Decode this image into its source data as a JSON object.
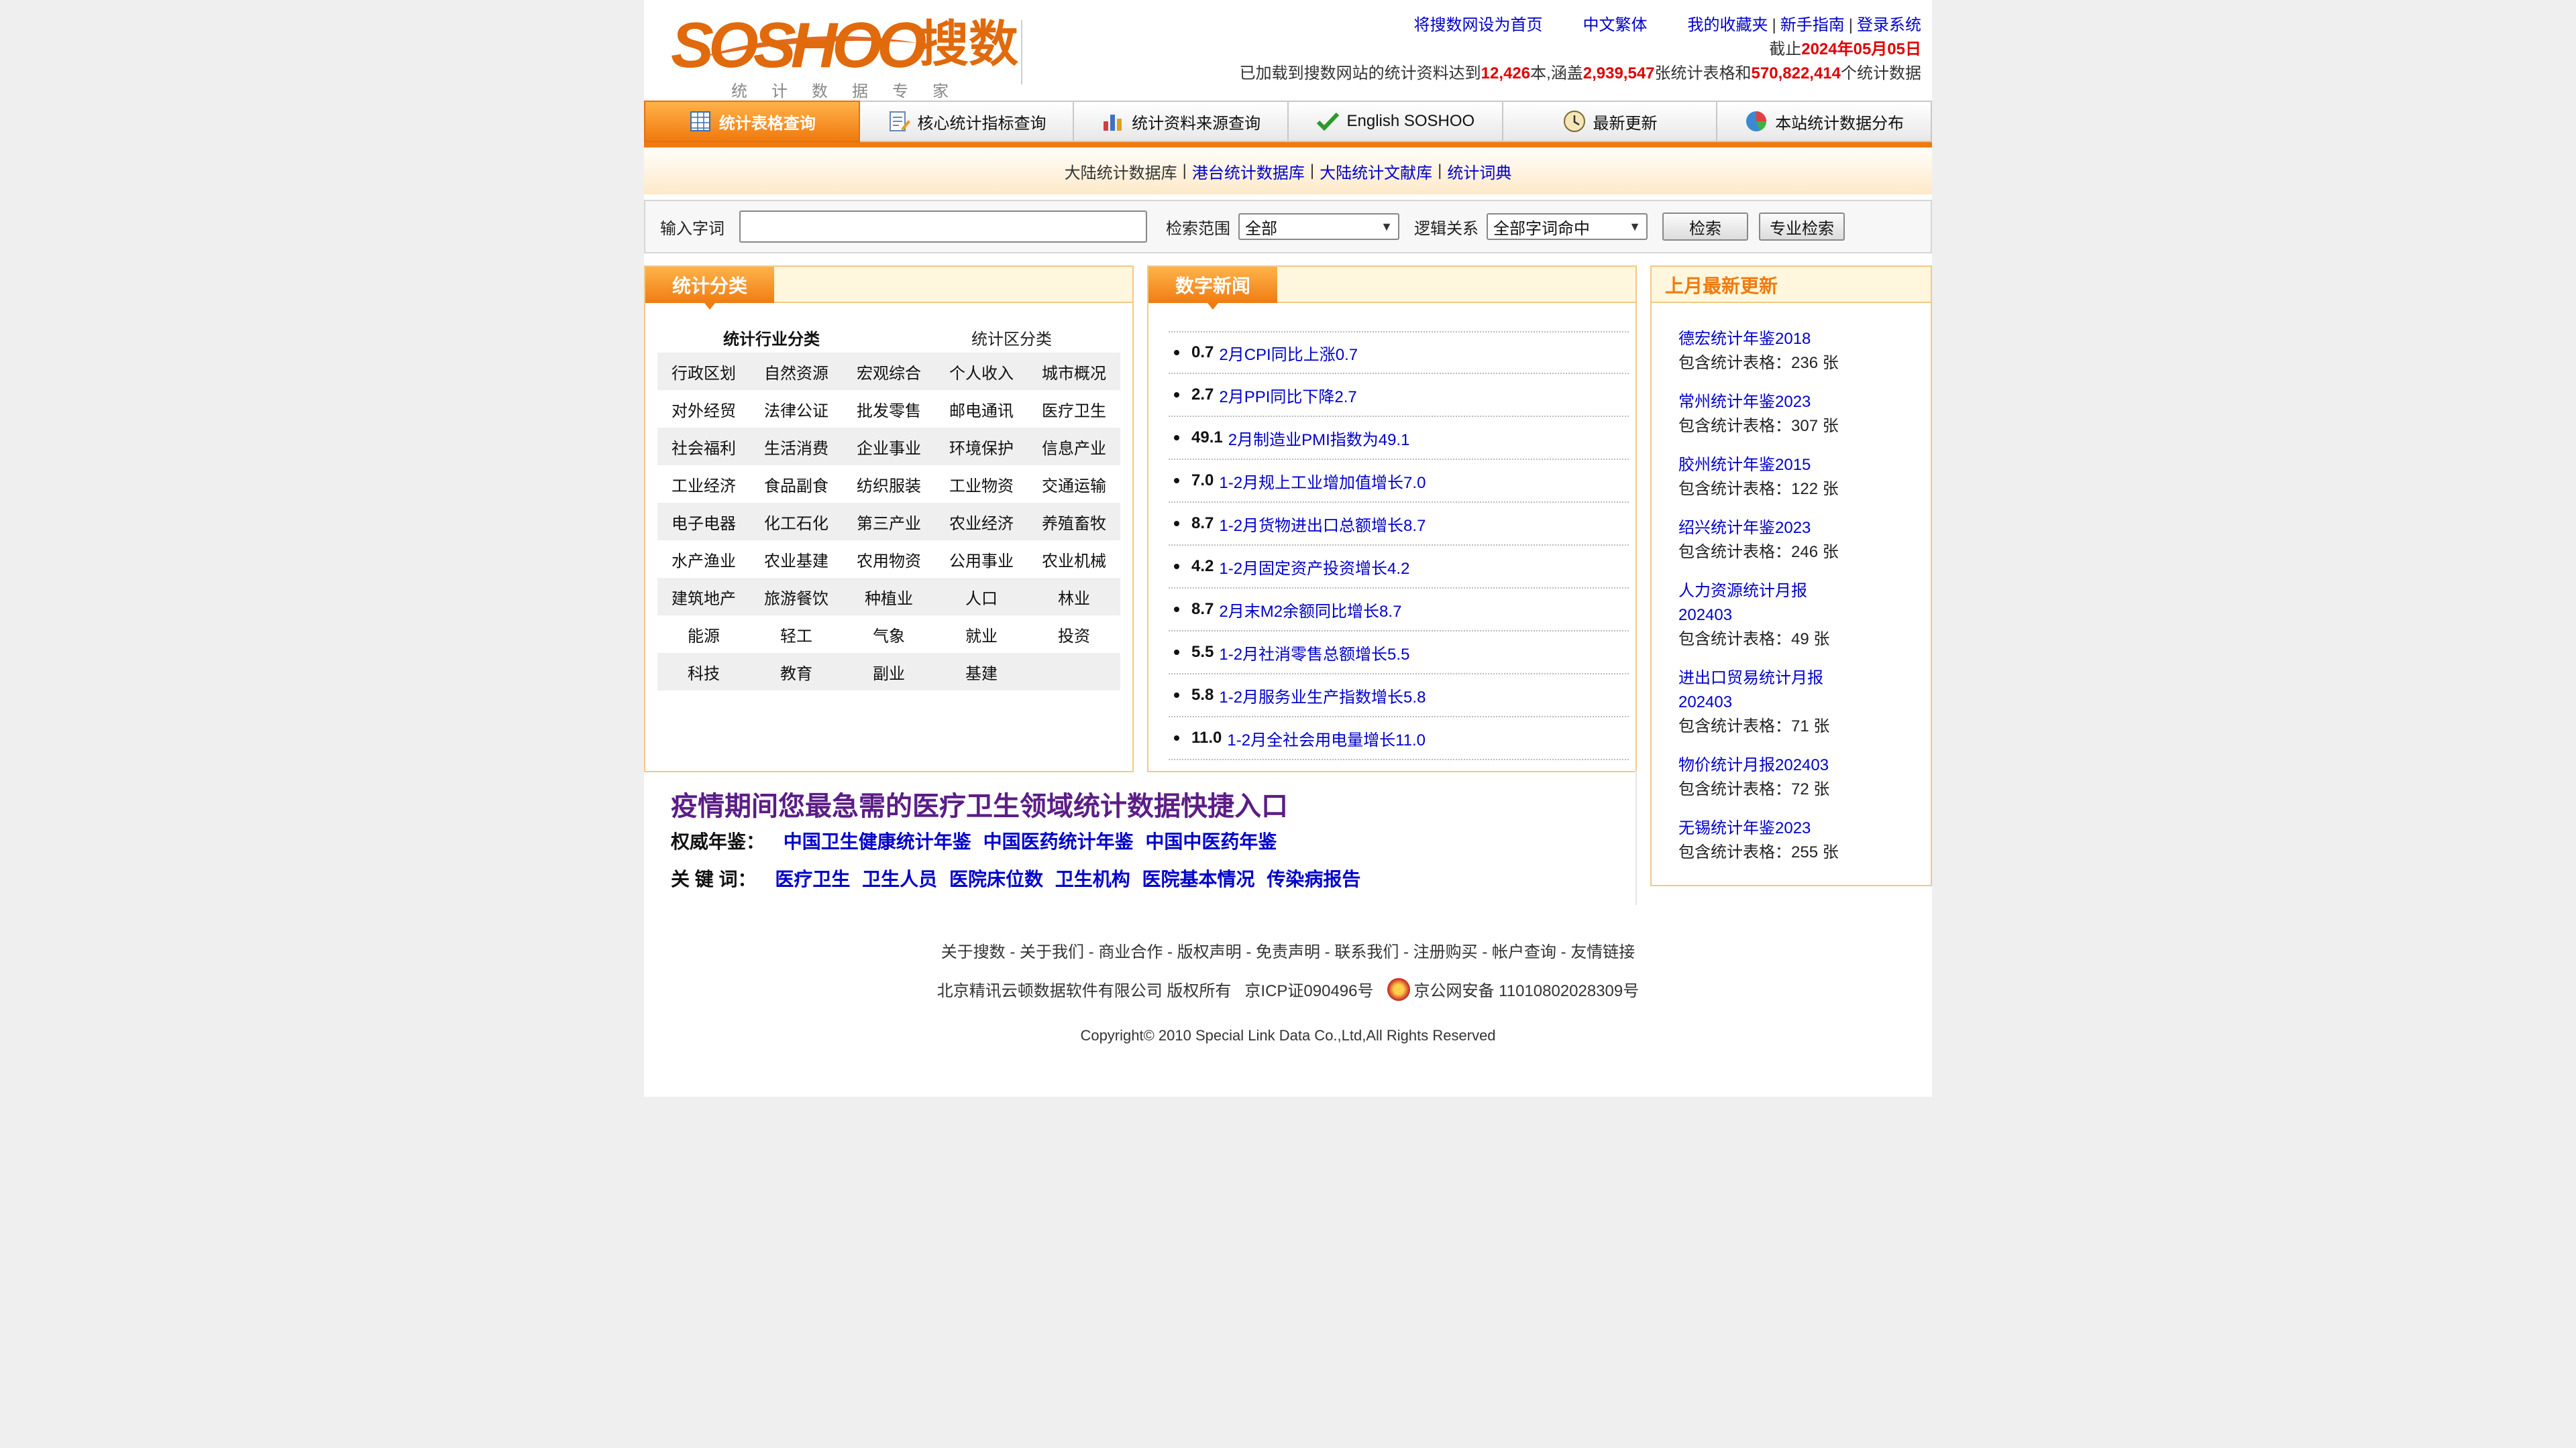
{
  "brand": {
    "logo_word": "SOSHOO",
    "logo_cn": "搜数",
    "logo_sub": "统计数据专家"
  },
  "top_links": {
    "set_home": "将搜数网设为首页",
    "traditional": "中文繁体",
    "favorites": "我的收藏夹",
    "guide": "新手指南",
    "login": "登录系统",
    "sep": "|",
    "date_prefix": "截止",
    "date_value": "2024年05月05日",
    "stats_p1": "已加载到搜数网站的统计资料达到",
    "books": "12,426",
    "stats_p2": "本,涵盖",
    "tables": "2,939,547",
    "stats_p3": "张统计表格和",
    "data_count": "570,822,414",
    "stats_p4": "个统计数据"
  },
  "nav": {
    "tabs": [
      {
        "label": "统计表格查询",
        "icon": "table-icon",
        "active": true
      },
      {
        "label": "核心统计指标查询",
        "icon": "document-edit-icon",
        "active": false
      },
      {
        "label": "统计资料来源查询",
        "icon": "bar-chart-icon",
        "active": false
      },
      {
        "label": "English SOSHOO",
        "icon": "checkmark-icon",
        "active": false
      },
      {
        "label": "最新更新",
        "icon": "clock-icon",
        "active": false
      },
      {
        "label": "本站统计数据分布",
        "icon": "pie-chart-icon",
        "active": false
      }
    ]
  },
  "db_bar": {
    "items": [
      "大陆统计数据库",
      "港台统计数据库",
      "大陆统计文献库",
      "统计词典"
    ],
    "sep": "|"
  },
  "search": {
    "input_label": "输入字词",
    "input_value": "",
    "scope_label": "检索范围",
    "scope_value": "全部",
    "logic_label": "逻辑关系",
    "logic_value": "全部字词命中",
    "search_button": "检索",
    "advanced_button": "专业检索"
  },
  "categories": {
    "title": "统计分类",
    "industry_head": "统计行业分类",
    "region_head": "统计区分类",
    "rows": [
      [
        "行政区划",
        "自然资源",
        "宏观综合",
        "个人收入",
        "城市概况"
      ],
      [
        "对外经贸",
        "法律公证",
        "批发零售",
        "邮电通讯",
        "医疗卫生"
      ],
      [
        "社会福利",
        "生活消费",
        "企业事业",
        "环境保护",
        "信息产业"
      ],
      [
        "工业经济",
        "食品副食",
        "纺织服装",
        "工业物资",
        "交通运输"
      ],
      [
        "电子电器",
        "化工石化",
        "第三产业",
        "农业经济",
        "养殖畜牧"
      ],
      [
        "水产渔业",
        "农业基建",
        "农用物资",
        "公用事业",
        "农业机械"
      ],
      [
        "建筑地产",
        "旅游餐饮",
        "种植业",
        "人口",
        "林业"
      ],
      [
        "能源",
        "轻工",
        "气象",
        "就业",
        "投资"
      ],
      [
        "科技",
        "教育",
        "副业",
        "基建",
        ""
      ]
    ]
  },
  "news": {
    "title": "数字新闻",
    "items": [
      {
        "value": "0.7",
        "text": "2月CPI同比上涨0.7"
      },
      {
        "value": "2.7",
        "text": "2月PPI同比下降2.7"
      },
      {
        "value": "49.1",
        "text": "2月制造业PMI指数为49.1"
      },
      {
        "value": "7.0",
        "text": "1-2月规上工业增加值增长7.0"
      },
      {
        "value": "8.7",
        "text": "1-2月货物进出口总额增长8.7"
      },
      {
        "value": "4.2",
        "text": "1-2月固定资产投资增长4.2"
      },
      {
        "value": "8.7",
        "text": "2月末M2余额同比增长8.7"
      },
      {
        "value": "5.5",
        "text": "1-2月社消零售总额增长5.5"
      },
      {
        "value": "5.8",
        "text": "1-2月服务业生产指数增长5.8"
      },
      {
        "value": "11.0",
        "text": "1-2月全社会用电量增长11.0"
      }
    ]
  },
  "updates": {
    "title": "上月最新更新",
    "items": [
      {
        "name": [
          "德宏统计年鉴2018"
        ],
        "count": "包含统计表格：236 张"
      },
      {
        "name": [
          "常州统计年鉴2023"
        ],
        "count": "包含统计表格：307 张"
      },
      {
        "name": [
          "胶州统计年鉴2015"
        ],
        "count": "包含统计表格：122 张"
      },
      {
        "name": [
          "绍兴统计年鉴2023"
        ],
        "count": "包含统计表格：246 张"
      },
      {
        "name": [
          "人力资源统计月报",
          "202403"
        ],
        "count": "包含统计表格：49 张"
      },
      {
        "name": [
          "进出口贸易统计月报",
          "202403"
        ],
        "count": "包含统计表格：71 张"
      },
      {
        "name": [
          "物价统计月报202403"
        ],
        "count": "包含统计表格：72 张"
      },
      {
        "name": [
          "无锡统计年鉴2023"
        ],
        "count": "包含统计表格：255 张"
      }
    ]
  },
  "epidemic": {
    "title": "疫情期间您最急需的医疗卫生领域统计数据快捷入口",
    "yearbook_label": "权威年鉴：",
    "yearbooks": [
      "中国卫生健康统计年鉴",
      "中国医药统计年鉴",
      "中国中医药年鉴"
    ],
    "keyword_label": "关 键 词：",
    "keywords": [
      "医疗卫生",
      "卫生人员",
      "医院床位数",
      "卫生机构",
      "医院基本情况",
      "传染病报告"
    ]
  },
  "footer": {
    "links": [
      "关于搜数",
      "关于我们",
      "商业合作",
      "版权声明",
      "免责声明",
      "联系我们",
      "注册购买",
      "帐户查询",
      "友情链接"
    ],
    "owner": "北京精讯云顿数据软件有限公司 版权所有",
    "icp": "京ICP证090496号",
    "police": "京公网安备 11010802028309号",
    "copyright": "Copyright© 2010 Special Link Data Co.,Ltd,All Rights Reserved"
  },
  "colors": {
    "accent": "#f07a0e",
    "link": "#0000cc",
    "highlight_red": "#e00000",
    "epidemic_title": "#5b1d86",
    "panel_border": "#f2c889"
  }
}
